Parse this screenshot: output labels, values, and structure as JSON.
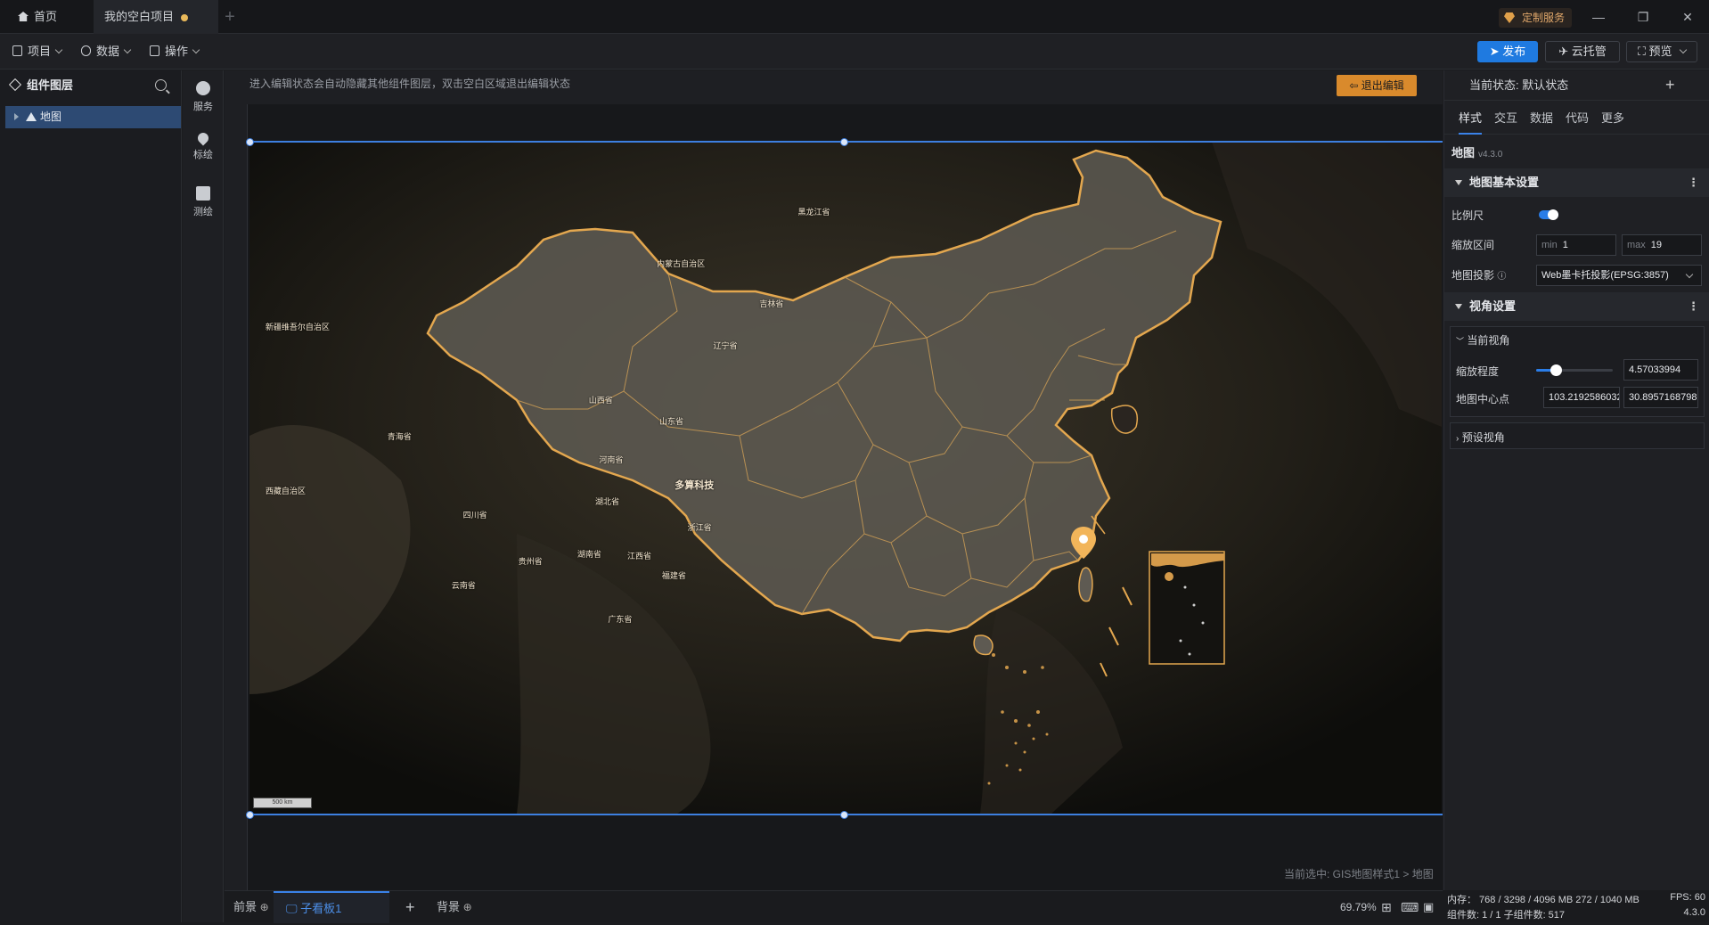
{
  "tabs": {
    "home": "首页",
    "project": "我的空白项目"
  },
  "custom_service": "定制服务",
  "toolbar": {
    "project": "项目",
    "data": "数据",
    "operate": "操作",
    "publish": "发布",
    "cloud": "云托管",
    "preview": "预览"
  },
  "layers": {
    "title": "组件图层",
    "items": [
      {
        "label": "地图"
      }
    ]
  },
  "sidetools": [
    {
      "label": "服务"
    },
    {
      "label": "标绘"
    },
    {
      "label": "测绘"
    }
  ],
  "canvas": {
    "hint": "进入编辑状态会自动隐藏其他组件图层，双击空白区域退出编辑状态",
    "exit_edit": "退出编辑",
    "selected": "当前选中: GIS地图样式1 > 地图",
    "scale_label": "500 km"
  },
  "map_labels": [
    {
      "text": "黑龙江省"
    },
    {
      "text": "内蒙古自治区"
    },
    {
      "text": "吉林省"
    },
    {
      "text": "辽宁省"
    },
    {
      "text": "新疆维吾尔自治区"
    },
    {
      "text": "山西省"
    },
    {
      "text": "山东省"
    },
    {
      "text": "青海省"
    },
    {
      "text": "河南省"
    },
    {
      "text": "西藏自治区"
    },
    {
      "text": "湖北省"
    },
    {
      "text": "多算科技"
    },
    {
      "text": "四川省"
    },
    {
      "text": "浙江省"
    },
    {
      "text": "湖南省"
    },
    {
      "text": "江西省"
    },
    {
      "text": "贵州省"
    },
    {
      "text": "福建省"
    },
    {
      "text": "云南省"
    },
    {
      "text": "广东省"
    }
  ],
  "bottom": {
    "foreground": "前景",
    "sub_board": "子看板1",
    "background": "背景",
    "zoom": "69.79%"
  },
  "right_panel": {
    "state": "当前状态:  默认状态",
    "tabs": [
      "样式",
      "交互",
      "数据",
      "代码",
      "更多"
    ],
    "component": "地图",
    "version": "v4.3.0",
    "section_basic": "地图基本设置",
    "scale_label": "比例尺",
    "zoom_range_label": "缩放区间",
    "min_label": "min",
    "min_value": "1",
    "max_label": "max",
    "max_value": "19",
    "projection_label": "地图投影",
    "projection_value": "Web墨卡托投影(EPSG:3857)",
    "section_view": "视角设置",
    "current_view": "当前视角",
    "zoom_level_label": "缩放程度",
    "zoom_level_value": "4.57033994",
    "center_label": "地图中心点",
    "center_lng": "103.2192586032",
    "center_lat": "30.8957168798",
    "preset_view": "预设视角"
  },
  "status": {
    "memory": "内存： 768 / 3298 / 4096 MB  272 / 1040 MB",
    "fps": "FPS:  60",
    "components": "组件数: 1 / 1    子组件数: 517",
    "version": "4.3.0"
  },
  "colors": {
    "accent": "#2a7de8",
    "map_border": "#e3a74f",
    "exit_btn": "#d98a2c"
  }
}
